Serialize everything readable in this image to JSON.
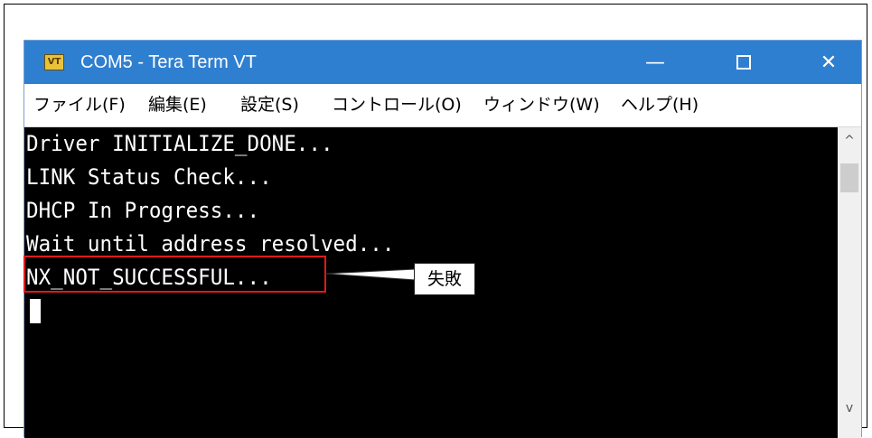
{
  "window": {
    "title": "COM5 - Tera Term VT",
    "app_icon_text": "VT",
    "minimize_label": "—",
    "close_label": "✕"
  },
  "menu": {
    "items": [
      "ファイル(F)",
      "編集(E)",
      "設定(S)",
      "コントロール(O)",
      "ウィンドウ(W)",
      "ヘルプ(H)"
    ]
  },
  "terminal": {
    "lines": [
      "Driver INITIALIZE_DONE...",
      "LINK Status Check...",
      "DHCP In Progress...",
      "Wait until address resolved...",
      "NX_NOT_SUCCESSFUL..."
    ]
  },
  "scrollbar": {
    "up_arrow": "^",
    "down_arrow": "v"
  },
  "annotation": {
    "label": "失敗",
    "highlight_color": "#e01a1a"
  },
  "colors": {
    "titlebar": "#2f7fd0",
    "terminal_background": "#000000",
    "terminal_text": "#ffffff"
  }
}
